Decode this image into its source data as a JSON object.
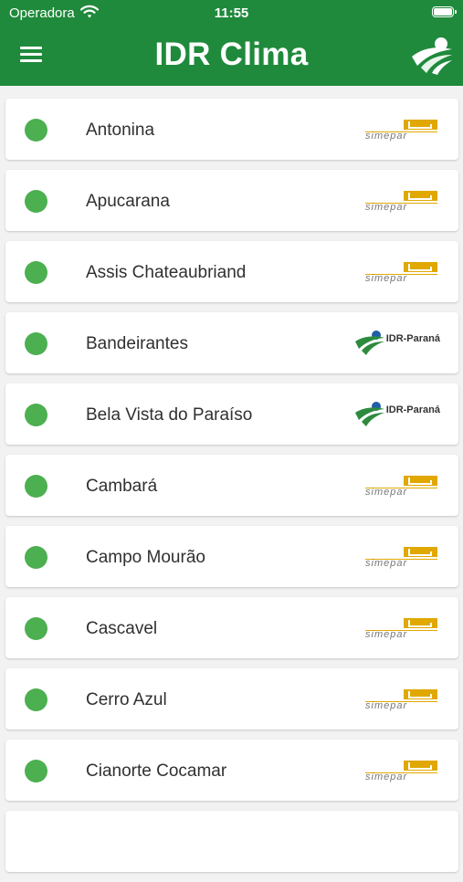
{
  "status_bar": {
    "carrier": "Operadora",
    "time": "11:55"
  },
  "header": {
    "title": "IDR Clima",
    "menu_icon": "hamburger-menu-icon",
    "logo": "idr-leaf-logo"
  },
  "colors": {
    "header": "#1f8a3b",
    "status_dot": "#4caf50",
    "simepar_gold": "#e0a800",
    "idr_green": "#2e8b3e",
    "idr_blue": "#1e5fa8"
  },
  "logos": {
    "simepar": "simepar",
    "idr": "IDR-Paraná"
  },
  "stations": [
    {
      "name": "Antonina",
      "source": "simepar",
      "status": "online"
    },
    {
      "name": "Apucarana",
      "source": "simepar",
      "status": "online"
    },
    {
      "name": "Assis Chateaubriand",
      "source": "simepar",
      "status": "online"
    },
    {
      "name": "Bandeirantes",
      "source": "idr",
      "status": "online"
    },
    {
      "name": "Bela Vista do Paraíso",
      "source": "idr",
      "status": "online"
    },
    {
      "name": "Cambará",
      "source": "simepar",
      "status": "online"
    },
    {
      "name": "Campo Mourão",
      "source": "simepar",
      "status": "online"
    },
    {
      "name": "Cascavel",
      "source": "simepar",
      "status": "online"
    },
    {
      "name": "Cerro Azul",
      "source": "simepar",
      "status": "online"
    },
    {
      "name": "Cianorte Cocamar",
      "source": "simepar",
      "status": "online"
    }
  ]
}
